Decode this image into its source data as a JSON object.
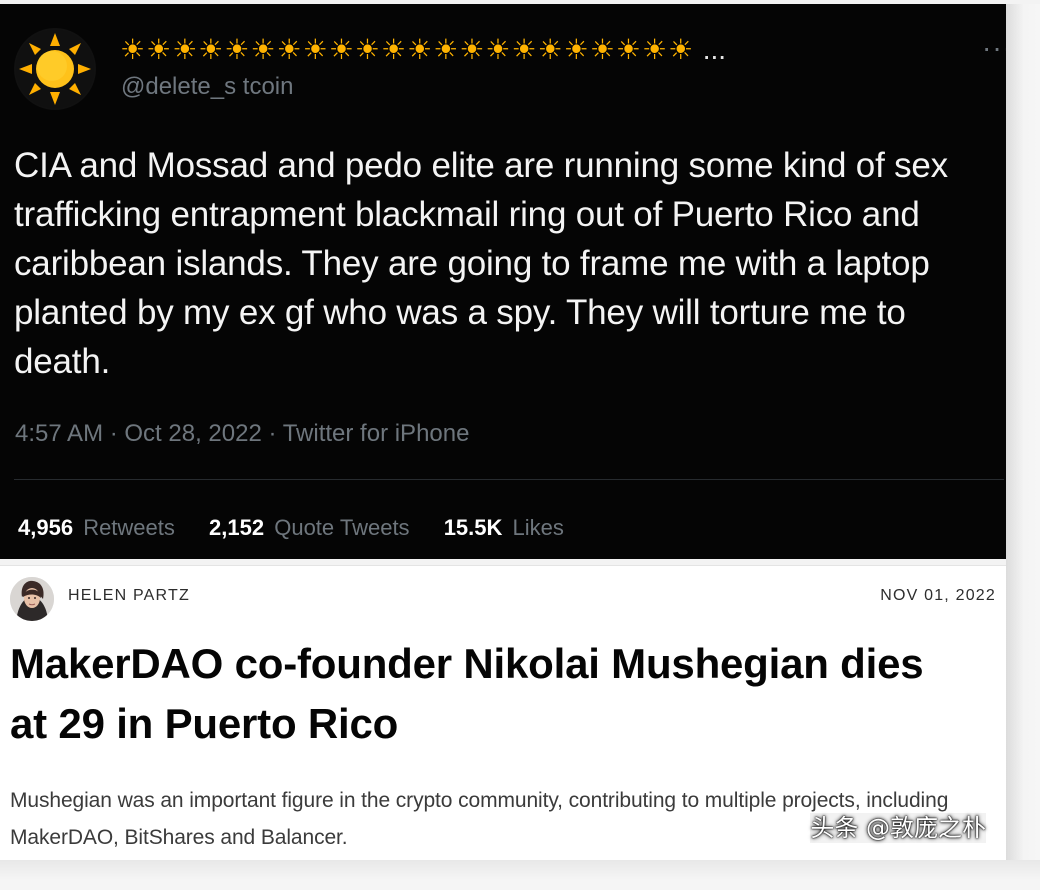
{
  "colors": {
    "tweet_background": "#050505",
    "sun_accent": "#ffb300",
    "article_background": "#ffffff"
  },
  "tweet": {
    "avatar_icon": "sun-icon",
    "display_name": "☀☀☀☀☀☀☀☀☀☀☀☀☀☀☀☀☀☀☀☀☀☀",
    "display_name_suffix": "...",
    "handle": "@delete_s  tcoin",
    "more_icon": "more-horizontal-icon",
    "more_label": "···",
    "text": "CIA and Mossad and pedo elite are running some kind of sex trafficking entrapment blackmail ring out of Puerto Rico and caribbean islands. They are going to frame me with a laptop planted by my ex gf who was a spy. They will torture me to death.",
    "meta": "4:57 AM · Oct 28, 2022 · Twitter for iPhone",
    "stats": [
      {
        "value": "4,956",
        "label": "Retweets"
      },
      {
        "value": "2,152",
        "label": "Quote Tweets"
      },
      {
        "value": "15.5K",
        "label": "Likes"
      }
    ]
  },
  "article": {
    "author": "HELEN PARTZ",
    "date": "NOV 01, 2022",
    "title": "MakerDAO co-founder Nikolai Mushegian dies at 29 in Puerto Rico",
    "summary": "Mushegian was an important figure in the crypto community, contributing to multiple projects, including MakerDAO, BitShares and Balancer."
  },
  "watermark": "头条 @敦庞之朴"
}
